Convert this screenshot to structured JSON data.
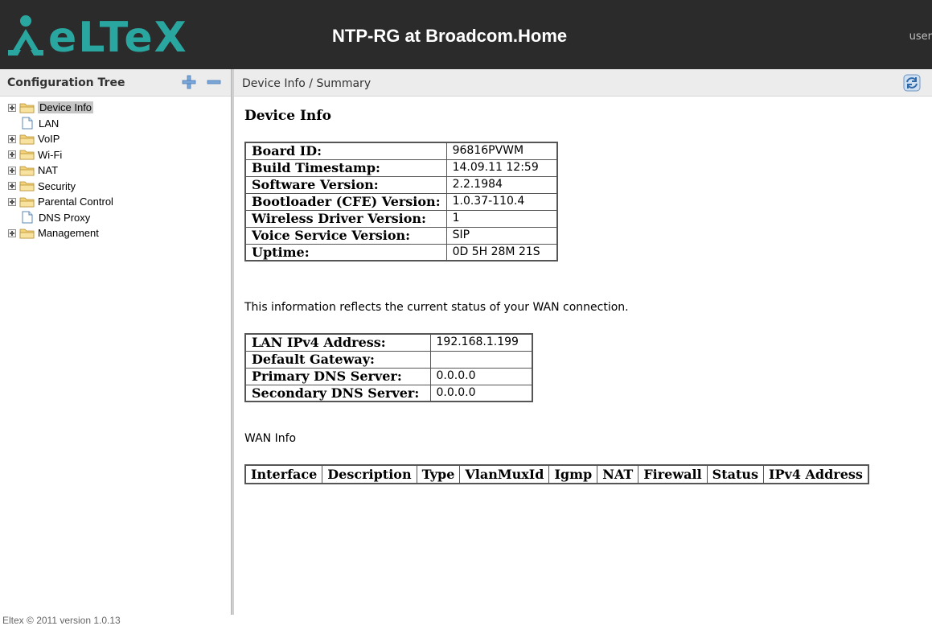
{
  "header": {
    "logo_text": "eLTeX",
    "title": "NTP-RG at Broadcom.Home",
    "user": "user"
  },
  "sidebar": {
    "title": "Configuration Tree",
    "expand_icon": "plus-icon",
    "collapse_icon": "minus-icon",
    "items": [
      {
        "label": "Device Info",
        "type": "folder",
        "expandable": true,
        "selected": true
      },
      {
        "label": "LAN",
        "type": "page",
        "expandable": false
      },
      {
        "label": "VoIP",
        "type": "folder",
        "expandable": true
      },
      {
        "label": "Wi-Fi",
        "type": "folder",
        "expandable": true
      },
      {
        "label": "NAT",
        "type": "folder",
        "expandable": true
      },
      {
        "label": "Security",
        "type": "folder",
        "expandable": true
      },
      {
        "label": "Parental Control",
        "type": "folder",
        "expandable": true
      },
      {
        "label": "DNS Proxy",
        "type": "page",
        "expandable": false
      },
      {
        "label": "Management",
        "type": "folder",
        "expandable": true
      }
    ]
  },
  "content": {
    "breadcrumb": "Device Info / Summary",
    "page_title": "Device Info",
    "device_info": [
      {
        "key": "Board ID:",
        "value": "96816PVWM"
      },
      {
        "key": "Build Timestamp:",
        "value": "14.09.11 12:59"
      },
      {
        "key": "Software Version:",
        "value": "2.2.1984"
      },
      {
        "key": "Bootloader (CFE) Version:",
        "value": "1.0.37-110.4"
      },
      {
        "key": "Wireless Driver Version:",
        "value": "1"
      },
      {
        "key": "Voice Service Version:",
        "value": "SIP"
      },
      {
        "key": "Uptime:",
        "value": "0D 5H 28M 21S"
      }
    ],
    "status_text": "This information reflects the current status of your WAN connection.",
    "lan_info": [
      {
        "key": "LAN IPv4 Address:",
        "value": "192.168.1.199"
      },
      {
        "key": "Default Gateway:",
        "value": ""
      },
      {
        "key": "Primary DNS Server:",
        "value": "0.0.0.0"
      },
      {
        "key": "Secondary DNS Server:",
        "value": "0.0.0.0"
      }
    ],
    "wan_title": "WAN Info",
    "wan_columns": [
      "Interface",
      "Description",
      "Type",
      "VlanMuxId",
      "Igmp",
      "NAT",
      "Firewall",
      "Status",
      "IPv4 Address"
    ]
  },
  "footer": {
    "text": "Eltex © 2011 version 1.0.13"
  },
  "colors": {
    "header_bg": "#2b2b2b",
    "logo": "#2aa6a0",
    "panel_header_bg": "#ececec"
  }
}
